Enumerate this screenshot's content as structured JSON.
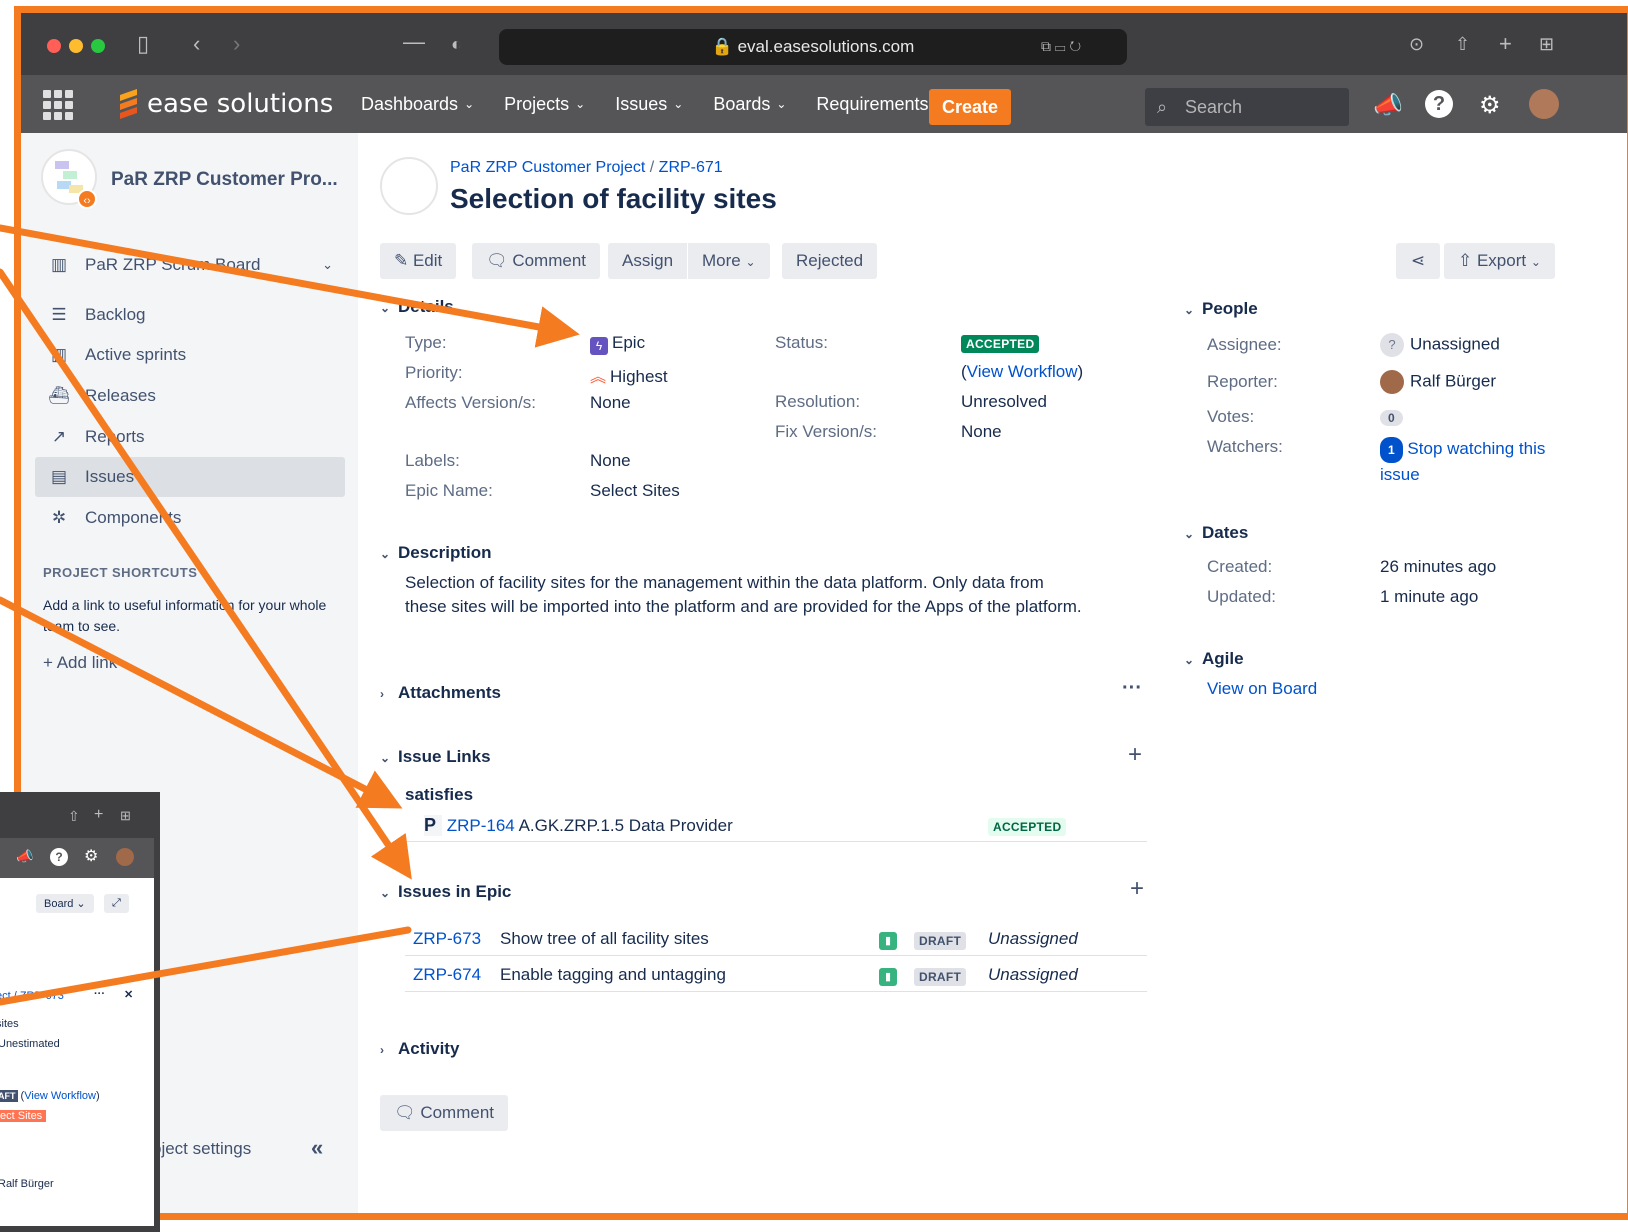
{
  "browser": {
    "url": "eval.easesolutions.com"
  },
  "app": {
    "logo_text": "ease solutions",
    "nav": [
      {
        "label": "Dashboards"
      },
      {
        "label": "Projects"
      },
      {
        "label": "Issues"
      },
      {
        "label": "Boards"
      },
      {
        "label": "Requirements"
      }
    ],
    "create_label": "Create",
    "search_placeholder": "Search"
  },
  "sidebar": {
    "project_name": "PaR ZRP Customer Pro...",
    "board_label": "PaR ZRP Scrum Board",
    "items": [
      {
        "label": "Backlog",
        "icon": "backlog-icon"
      },
      {
        "label": "Active sprints",
        "icon": "sprints-icon"
      },
      {
        "label": "Releases",
        "icon": "releases-icon"
      },
      {
        "label": "Reports",
        "icon": "reports-icon"
      },
      {
        "label": "Issues",
        "icon": "issues-icon"
      },
      {
        "label": "Components",
        "icon": "components-icon"
      }
    ],
    "shortcuts_heading": "PROJECT SHORTCUTS",
    "shortcuts_text": "Add a link to useful information for your whole team to see.",
    "add_link": "Add link",
    "settings": "Project settings"
  },
  "issue": {
    "breadcrumb_project": "PaR ZRP Customer Project",
    "breadcrumb_key": "ZRP-671",
    "title": "Selection of facility sites",
    "actions": {
      "edit": "Edit",
      "comment": "Comment",
      "assign": "Assign",
      "more": "More",
      "rejected": "Rejected",
      "export": "Export"
    },
    "details": {
      "heading": "Details",
      "type_label": "Type:",
      "type_value": "Epic",
      "priority_label": "Priority:",
      "priority_value": "Highest",
      "affects_label": "Affects Version/s:",
      "affects_value": "None",
      "labels_label": "Labels:",
      "labels_value": "None",
      "epic_name_label": "Epic Name:",
      "epic_name_value": "Select Sites",
      "status_label": "Status:",
      "status_value": "ACCEPTED",
      "view_workflow": "View Workflow",
      "resolution_label": "Resolution:",
      "resolution_value": "Unresolved",
      "fix_label": "Fix Version/s:",
      "fix_value": "None"
    },
    "description": {
      "heading": "Description",
      "text": "Selection of facility sites for the management within the data platform. Only data from these sites will be imported into the platform and are provided for the Apps of the platform."
    },
    "attachments_heading": "Attachments",
    "links": {
      "heading": "Issue Links",
      "relation": "satisfies",
      "key": "ZRP-164",
      "summary": "A.GK.ZRP.1.5 Data Provider",
      "status": "ACCEPTED",
      "type_letter": "P"
    },
    "epic_issues": {
      "heading": "Issues in Epic",
      "rows": [
        {
          "key": "ZRP-673",
          "summary": "Show tree of all facility sites",
          "status": "DRAFT",
          "assignee": "Unassigned"
        },
        {
          "key": "ZRP-674",
          "summary": "Enable tagging and untagging",
          "status": "DRAFT",
          "assignee": "Unassigned"
        }
      ]
    },
    "activity_heading": "Activity",
    "comment_button": "Comment"
  },
  "people": {
    "heading": "People",
    "assignee_label": "Assignee:",
    "assignee_value": "Unassigned",
    "reporter_label": "Reporter:",
    "reporter_value": "Ralf Bürger",
    "votes_label": "Votes:",
    "votes_value": "0",
    "watchers_label": "Watchers:",
    "watchers_count": "1",
    "watchers_link": "Stop watching this issue"
  },
  "dates": {
    "heading": "Dates",
    "created_label": "Created:",
    "created_value": "26 minutes ago",
    "updated_label": "Updated:",
    "updated_value": "1 minute ago"
  },
  "agile": {
    "heading": "Agile",
    "link": "View on Board"
  },
  "inset": {
    "board_button": "Board",
    "crumb": "ect / ZRP-673",
    "line1": "sites",
    "line2": "Unestimated",
    "status": "AFT",
    "view_workflow": "View Workflow",
    "epic_tag": "ect Sites",
    "reporter": "Ralf Bürger"
  },
  "colors": {
    "accent": "#f47b20",
    "link": "#0052cc",
    "accepted": "#00875a",
    "epic": "#6554c0"
  }
}
